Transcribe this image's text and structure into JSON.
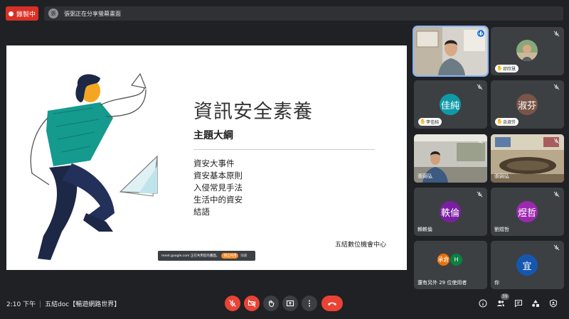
{
  "top_bar": {
    "recording_label": "錄製中",
    "presenter_avatar": "張",
    "sharing_text": "張弼正在分享螢幕畫面"
  },
  "slide": {
    "title": "資訊安全素養",
    "subtitle": "主題大綱",
    "outline": [
      "資安大事件",
      "資安基本原則",
      "入侵常見手法",
      "生活中的資安",
      "結語"
    ],
    "footer": "五結數位機會中心",
    "toast_text": "meet.google.com 正在共用您的畫面。",
    "toast_stop": "停止共用",
    "toast_hide": "隱藏"
  },
  "participants": [
    {
      "name": "",
      "type": "video",
      "speaking": true
    },
    {
      "name": "邱欣慧",
      "type": "photo",
      "hand": true
    },
    {
      "name": "李佳純",
      "type": "avatar",
      "initials": "佳純",
      "color": "#0f9aa8",
      "hand": true
    },
    {
      "name": "余淑芬",
      "type": "avatar",
      "initials": "淑芬",
      "color": "#795548",
      "hand": true
    },
    {
      "name": "張弼弘",
      "type": "video"
    },
    {
      "name": "張弼弘",
      "type": "video"
    },
    {
      "name": "賴軼倫",
      "type": "avatar",
      "initials": "軼倫",
      "color": "#7b1fa2"
    },
    {
      "name": "劉煜哲",
      "type": "avatar",
      "initials": "煜哲",
      "color": "#9c27b0"
    },
    {
      "name": "還有另外 29 位使用者",
      "type": "others",
      "minis": [
        {
          "t": "承倉",
          "c": "#e8710a"
        },
        {
          "t": "H",
          "c": "#0b8043"
        }
      ]
    },
    {
      "name": "你",
      "type": "avatar",
      "initials": "宜",
      "color": "#1557b0"
    }
  ],
  "bottom_bar": {
    "time": "2:10 下午",
    "meeting_name": "五結doc【暢遊網路世界】",
    "people_count": "39"
  },
  "icons": [
    "mic-off-icon",
    "camera-off-icon",
    "raise-hand-icon",
    "present-icon",
    "more-icon",
    "hang-up-icon",
    "info-icon",
    "people-icon",
    "chat-icon",
    "activities-icon",
    "host-controls-icon"
  ],
  "colors": {
    "record_red": "#d93025",
    "hangup_red": "#ea4335",
    "background": "#202124",
    "tile": "#3c4043",
    "accent_blue": "#1a73e8"
  }
}
